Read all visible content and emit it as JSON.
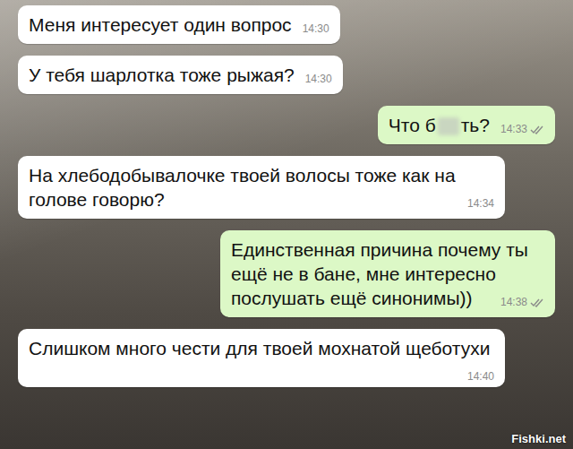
{
  "messages": [
    {
      "kind": "incoming",
      "text": "Меня интересует один вопрос",
      "censored": false,
      "text_after": "",
      "time": "14:30",
      "read": false
    },
    {
      "kind": "incoming",
      "text": "У тебя шарлотка тоже рыжая?",
      "censored": false,
      "text_after": "",
      "time": "14:30",
      "read": false
    },
    {
      "kind": "outgoing",
      "text": "Что б",
      "censored": true,
      "text_after": "ть?",
      "time": "14:33",
      "read": true
    },
    {
      "kind": "incoming",
      "text": "На хлебодобывалочке твоей волосы тоже как на голове говорю?",
      "censored": false,
      "text_after": "",
      "time": "14:34",
      "read": false
    },
    {
      "kind": "outgoing",
      "text": "Единственная причина почему ты ещё не в бане, мне интересно послушать ещё синонимы))",
      "censored": false,
      "text_after": "",
      "time": "14:38",
      "read": true
    },
    {
      "kind": "incoming",
      "text": "Слишком много чести для твоей мохнатой щеботухи",
      "censored": false,
      "text_after": "",
      "time": "14:40",
      "read": false
    }
  ],
  "watermark": "Fishki.net"
}
